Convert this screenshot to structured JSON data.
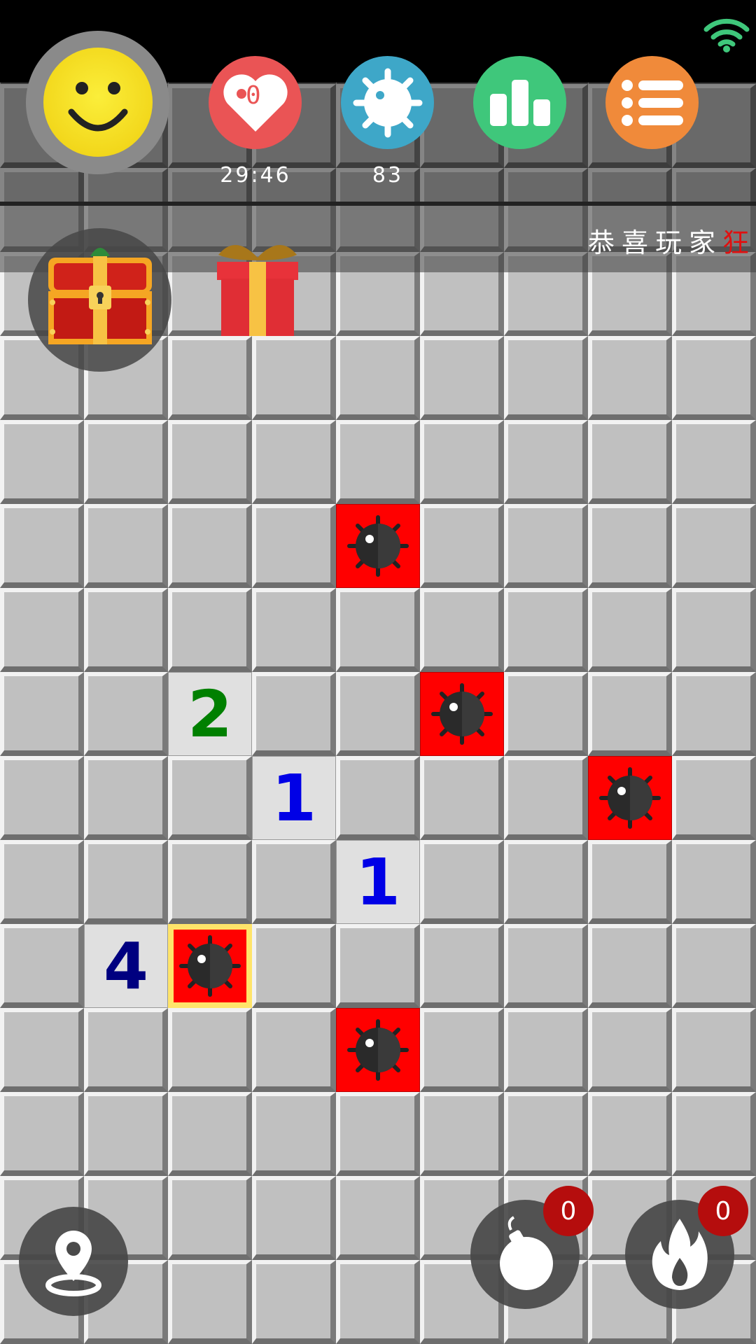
{
  "status_bar": {
    "wifi_icon": "wifi-icon"
  },
  "header": {
    "smiley_icon": "smiley-face-icon",
    "lives": {
      "icon": "heart-icon",
      "value": "0",
      "label": "29:46"
    },
    "mines": {
      "icon": "mine-icon",
      "label": "83"
    },
    "stats": {
      "icon": "bar-chart-icon"
    },
    "menu": {
      "icon": "list-menu-icon"
    }
  },
  "ticker": {
    "text": "恭喜玩家",
    "highlight": "狂"
  },
  "rewards": {
    "chest_icon": "treasure-chest-icon",
    "gift_icon": "gift-box-icon"
  },
  "board": {
    "columns": 9,
    "rows": 16,
    "cells": [
      {
        "r": 6,
        "c": 4,
        "t": "mine"
      },
      {
        "r": 8,
        "c": 2,
        "t": "num",
        "v": "2",
        "cls": "n2"
      },
      {
        "r": 8,
        "c": 5,
        "t": "mine"
      },
      {
        "r": 9,
        "c": 3,
        "t": "num",
        "v": "1",
        "cls": "n1"
      },
      {
        "r": 9,
        "c": 7,
        "t": "mine"
      },
      {
        "r": 10,
        "c": 4,
        "t": "num",
        "v": "1",
        "cls": "n1"
      },
      {
        "r": 11,
        "c": 1,
        "t": "num",
        "v": "4",
        "cls": "n4"
      },
      {
        "r": 11,
        "c": 2,
        "t": "mine-hit"
      },
      {
        "r": 12,
        "c": 4,
        "t": "mine"
      }
    ]
  },
  "tools": {
    "locate_icon": "location-pin-icon",
    "bomb": {
      "icon": "bomb-icon",
      "count": "0"
    },
    "fire": {
      "icon": "flame-icon",
      "count": "0"
    }
  },
  "colors": {
    "heart": "#ea5455",
    "mine_btn": "#3ea7c8",
    "stats": "#3fc77b",
    "menu": "#f08a3a",
    "smiley": "#f7e11c",
    "mine_cell": "#ff0000",
    "badge": "#b50d0d"
  }
}
